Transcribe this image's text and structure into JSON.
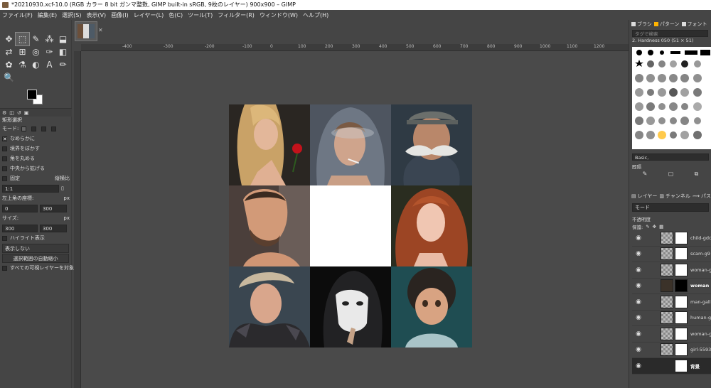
{
  "window": {
    "title": "*20210930.xcf-10.0 (RGB カラー 8 bit ガンマ整数, GIMP built-in sRGB, 9枚のレイヤー) 900x900 – GIMP"
  },
  "menu": [
    "ファイル(F)",
    "編集(E)",
    "選択(S)",
    "表示(V)",
    "画像(I)",
    "レイヤー(L)",
    "色(C)",
    "ツール(T)",
    "フィルター(R)",
    "ウィンドウ(W)",
    "ヘルプ(H)"
  ],
  "tools": [
    "✥",
    "⬚",
    "✎",
    "⁂",
    "⬓",
    "⇄",
    "⊞",
    "◎",
    "✑",
    "◧",
    "✿",
    "⚗",
    "◐",
    "A",
    "✏",
    "🔍"
  ],
  "tool_options": {
    "title": "矩形選択",
    "mode_label": "モード:",
    "antialias": "なめらかに",
    "feather": "境界をぼかす",
    "rounded": "角を丸める",
    "expand_center": "中央から拡げる",
    "fixed": "固定",
    "fixed_mode": "縦横比",
    "ratio": "1:1",
    "position_label": "左上角の座標:",
    "unit_px": "px",
    "pos_x": "0",
    "pos_y": "300",
    "size_label": "サイズ:",
    "size_w": "300",
    "size_h": "300",
    "highlight": "ハイライト表示",
    "guides": "表示しない",
    "auto_shrink": "選択範囲の自動縮小",
    "merged": "すべての可視レイヤーを対象に"
  },
  "rulers": [
    "-400",
    "-300",
    "-200",
    "-100",
    "0",
    "100",
    "200",
    "300",
    "400",
    "500",
    "600",
    "700",
    "800",
    "900",
    "1000",
    "1100",
    "1200",
    "1300"
  ],
  "dock": {
    "tabs": [
      "ブラシ",
      "パターン",
      "フォント"
    ],
    "filter_placeholder": "タグで検索",
    "brush_name": "2. Hardness 050 (51 × 51)",
    "brush_tag": "Basic,",
    "spacing_label": "間隔",
    "layer_tabs": [
      "レイヤー",
      "チャンネル",
      "パス"
    ],
    "mode_label": "モード",
    "opacity_label": "不透明度",
    "lock_label": "保護:"
  },
  "layers": [
    {
      "name": "child-gdc"
    },
    {
      "name": "scam-g9"
    },
    {
      "name": "woman-g"
    },
    {
      "name": "woman",
      "bold": true
    },
    {
      "name": "man-galli"
    },
    {
      "name": "human-g"
    },
    {
      "name": "woman-g"
    },
    {
      "name": "girl-5593"
    },
    {
      "name": "背景",
      "bold": true
    }
  ],
  "colors": {
    "accent": "#ffb400",
    "canvas_bg": "#4a4a4a",
    "panel": "#454545"
  }
}
